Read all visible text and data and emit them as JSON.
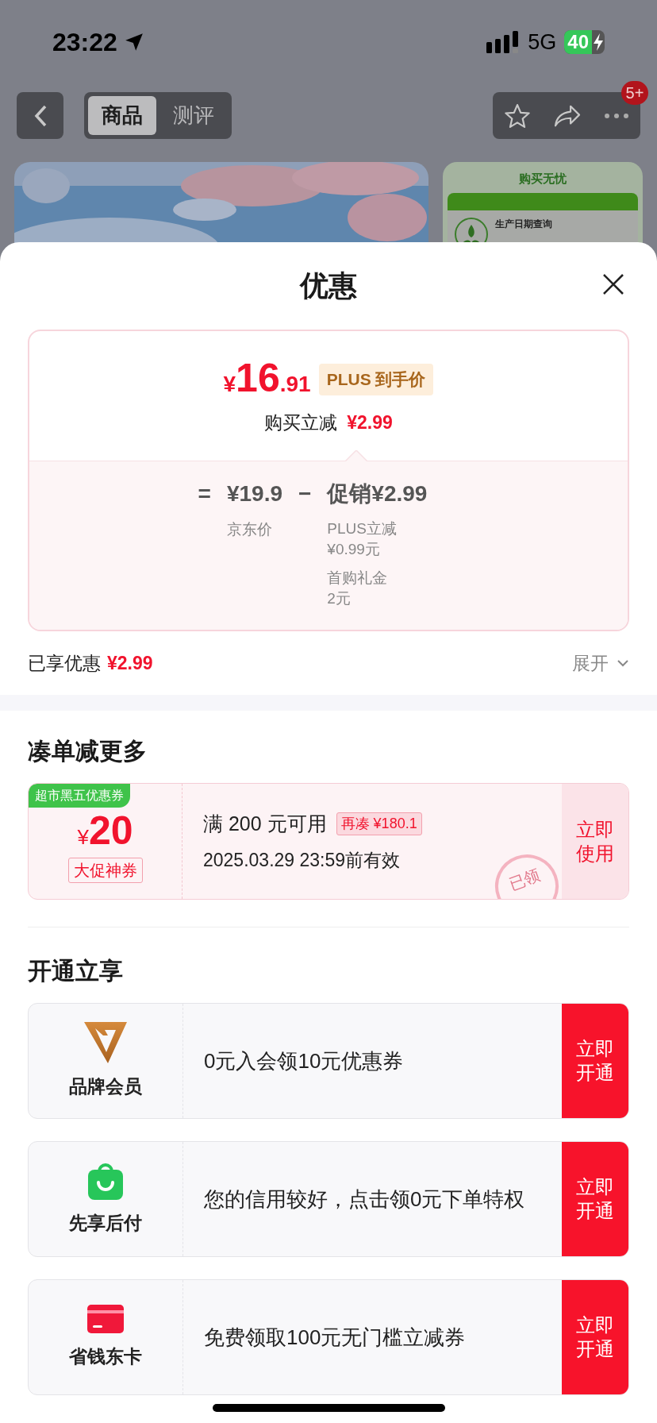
{
  "status_bar": {
    "time": "23:22",
    "network": "5G",
    "battery": "40"
  },
  "nav": {
    "tabs": [
      {
        "label": "商品",
        "selected": true
      },
      {
        "label": "测评",
        "selected": false
      }
    ],
    "badge": "5+"
  },
  "background_card": {
    "title": "购买无忧",
    "item": "生产日期查询"
  },
  "sheet": {
    "title": "优惠",
    "price": {
      "currency": "¥",
      "integer": "16",
      "decimal": ".91",
      "badge": "PLUS 到手价",
      "reduce_label": "购买立减",
      "reduce_amount": "¥2.99"
    },
    "formula": {
      "equals": "=",
      "base_amount": "¥19.9",
      "base_label": "京东价",
      "minus": "−",
      "promo_amount": "促销¥2.99",
      "details": [
        "PLUS立减\n¥0.99元",
        "首购礼金\n2元"
      ]
    },
    "enjoyed": {
      "label": "已享优惠",
      "amount": "¥2.99",
      "expand": "展开"
    },
    "coupon_section": {
      "title": "凑单减更多",
      "coupon": {
        "tag": "超市黑五优惠券",
        "currency": "¥",
        "amount": "20",
        "label": "大促神券",
        "condition": "满 200 元可用",
        "gap_tag": "再凑 ¥180.1",
        "validity": "2025.03.29 23:59前有效",
        "stamp": "已领",
        "action": "立即使用"
      }
    },
    "offers_section": {
      "title": "开通立享",
      "offers": [
        {
          "kind": "brand",
          "name": "品牌会员",
          "text": "0元入会领10元优惠券",
          "action": "立即开通"
        },
        {
          "kind": "paylater",
          "name": "先享后付",
          "text": "您的信用较好，点击领0元下单特权",
          "action": "立即开通"
        },
        {
          "kind": "card",
          "name": "省钱东卡",
          "text": "免费领取100元无门槛立减券",
          "action": "立即开通"
        }
      ]
    }
  }
}
